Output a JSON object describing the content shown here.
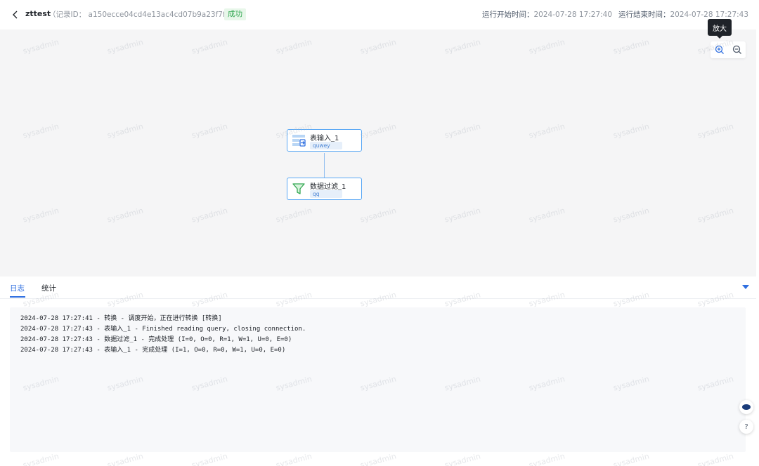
{
  "header": {
    "back_icon": "chevron-left-icon",
    "job_name": "zttest",
    "record_id": "（记录ID： a150ecce04cd4e13ac4cd07b9a23f7fb）",
    "status": "成功",
    "start_label": "运行开始时间：",
    "start_time": "2024-07-28 17:27:40",
    "end_label": "运行结束时间：",
    "end_time": "2024-07-28 17:27:43"
  },
  "canvas": {
    "watermark": "sysadmin",
    "zoom_in_tooltip": "放大",
    "nodes": [
      {
        "title": "表输入_1",
        "subtitle": "quwey",
        "icon": "table-input-icon"
      },
      {
        "title": "数据过滤_1",
        "subtitle": "qq",
        "icon": "filter-icon"
      }
    ]
  },
  "panel": {
    "tabs": [
      {
        "label": "日志",
        "active": true
      },
      {
        "label": "统计",
        "active": false
      }
    ],
    "log_lines": [
      "2024-07-28 17:27:41 - 转换 - 调度开始，正在进行转换 [转换]",
      "2024-07-28 17:27:43 - 表输入_1 - Finished reading query, closing connection.",
      "2024-07-28 17:27:43 - 数据过滤_1 - 完成处理 (I=0, O=0, R=1, W=1, U=0, E=0)",
      "2024-07-28 17:27:43 - 表输入_1 - 完成处理 (I=1, O=0, R=0, W=1, U=0, E=0)"
    ]
  },
  "floating": {
    "help_label": "?"
  },
  "colors": {
    "accent": "#2f6fe0",
    "success": "#34a853",
    "node_border": "#5aa8f5"
  }
}
